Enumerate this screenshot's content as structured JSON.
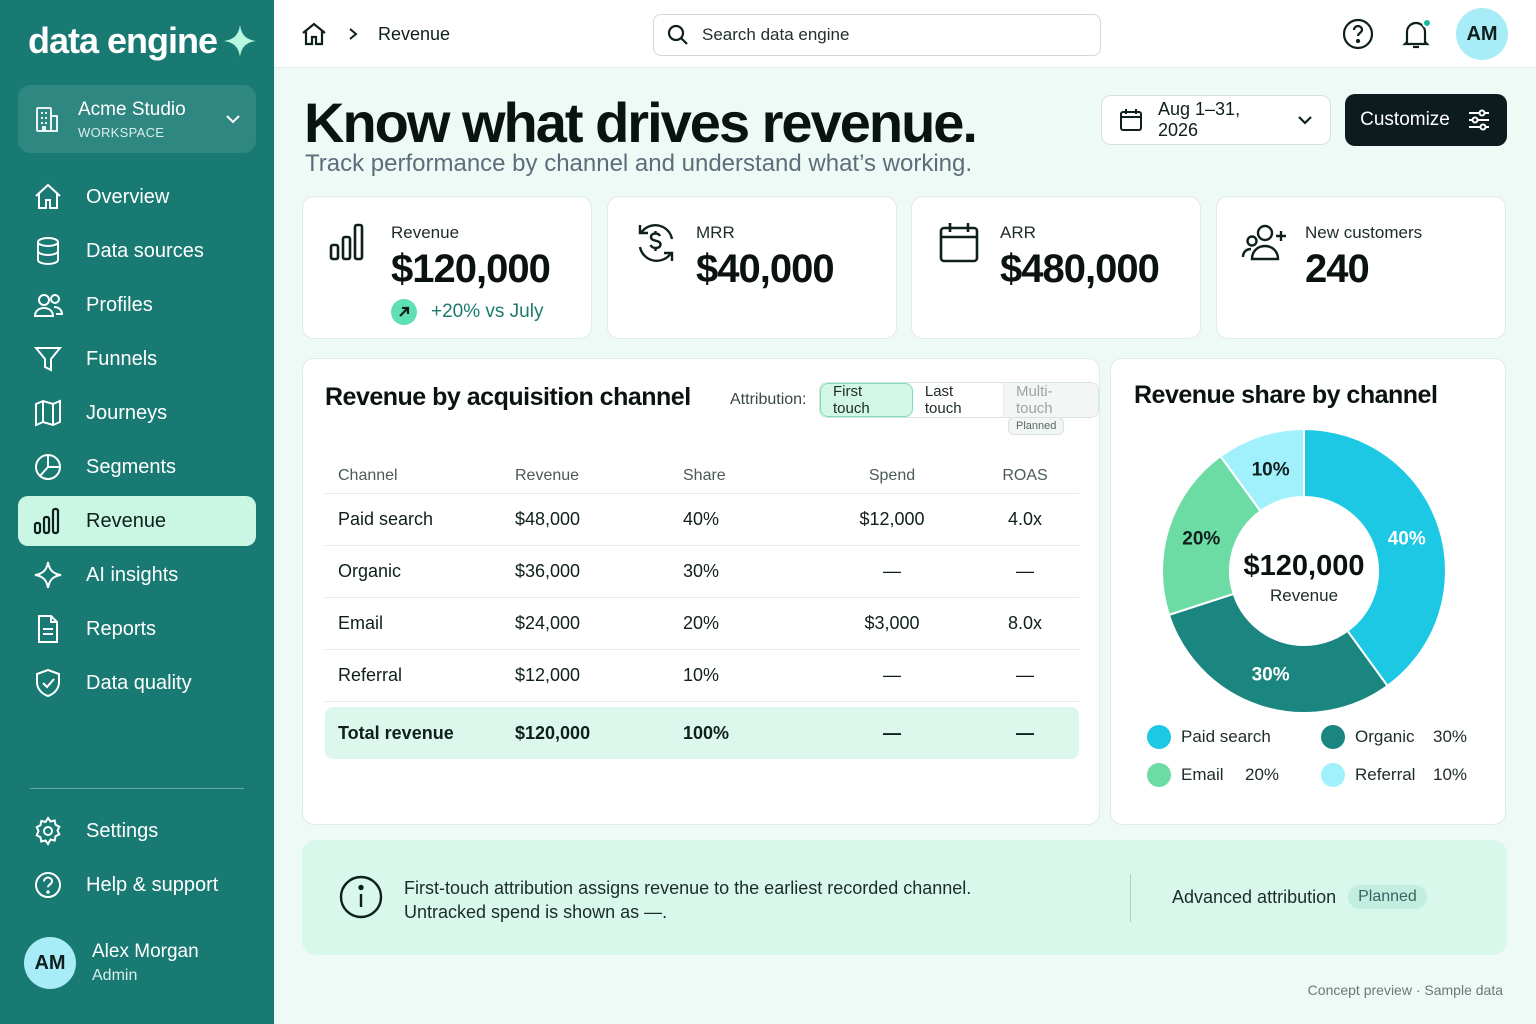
{
  "brand": {
    "name": "data engine"
  },
  "workspace": {
    "name": "Acme Studio",
    "label": "WORKSPACE"
  },
  "nav": {
    "items": [
      {
        "label": "Overview",
        "icon": "home-icon"
      },
      {
        "label": "Data sources",
        "icon": "database-icon"
      },
      {
        "label": "Profiles",
        "icon": "users-icon"
      },
      {
        "label": "Funnels",
        "icon": "funnel-icon"
      },
      {
        "label": "Journeys",
        "icon": "map-icon"
      },
      {
        "label": "Segments",
        "icon": "pie-icon"
      },
      {
        "label": "Revenue",
        "icon": "bar-chart-icon",
        "active": true
      },
      {
        "label": "AI insights",
        "icon": "sparkle-icon"
      },
      {
        "label": "Reports",
        "icon": "document-icon"
      },
      {
        "label": "Data quality",
        "icon": "shield-icon"
      }
    ],
    "bottom": [
      {
        "label": "Settings",
        "icon": "gear-icon"
      },
      {
        "label": "Help & support",
        "icon": "help-icon"
      }
    ]
  },
  "user": {
    "initials": "AM",
    "name": "Alex Morgan",
    "role": "Admin"
  },
  "topbar": {
    "breadcrumb": "Revenue",
    "search_placeholder": "Search data engine",
    "avatar_initials": "AM"
  },
  "header": {
    "title": "Know what drives revenue.",
    "subtitle": "Track performance by channel and understand what’s working.",
    "date_range": "Aug 1–31, 2026",
    "customize_label": "Customize"
  },
  "kpis": [
    {
      "label": "Revenue",
      "value": "$120,000",
      "delta": "+20% vs July",
      "icon": "bar-chart-icon"
    },
    {
      "label": "MRR",
      "value": "$40,000",
      "icon": "recurring-dollar-icon"
    },
    {
      "label": "ARR",
      "value": "$480,000",
      "icon": "calendar-icon"
    },
    {
      "label": "New customers",
      "value": "240",
      "icon": "add-users-icon"
    }
  ],
  "table_card": {
    "title": "Revenue by acquisition channel",
    "attribution_label": "Attribution:",
    "options": [
      "First touch",
      "Last touch",
      "Multi-touch"
    ],
    "selected": "First touch",
    "planned_label": "Planned",
    "columns": [
      "Channel",
      "Revenue",
      "Share",
      "Spend",
      "ROAS"
    ],
    "rows": [
      [
        "Paid search",
        "$48,000",
        "40%",
        "$12,000",
        "4.0x"
      ],
      [
        "Organic",
        "$36,000",
        "30%",
        "—",
        "—"
      ],
      [
        "Email",
        "$24,000",
        "20%",
        "$3,000",
        "8.0x"
      ],
      [
        "Referral",
        "$12,000",
        "10%",
        "—",
        "—"
      ]
    ],
    "total": [
      "Total revenue",
      "$120,000",
      "100%",
      "—",
      "—"
    ]
  },
  "chart_data": {
    "type": "pie",
    "title": "Revenue share by channel",
    "center_value": "$120,000",
    "center_label": "Revenue",
    "categories": [
      "Paid search",
      "Organic",
      "Email",
      "Referral"
    ],
    "values": [
      40,
      30,
      20,
      10
    ],
    "labels": [
      "40%",
      "30%",
      "20%",
      "10%"
    ],
    "colors": [
      "#1cc8e4",
      "#1b8580",
      "#6ddba4",
      "#a0f1fb"
    ],
    "legend_position": "bottom"
  },
  "banner": {
    "line1": "First-touch attribution assigns revenue to the earliest recorded channel.",
    "line2": "Untracked spend is shown as —.",
    "right_label": "Advanced attribution",
    "right_badge": "Planned"
  },
  "footer_note": "Concept preview · Sample data"
}
